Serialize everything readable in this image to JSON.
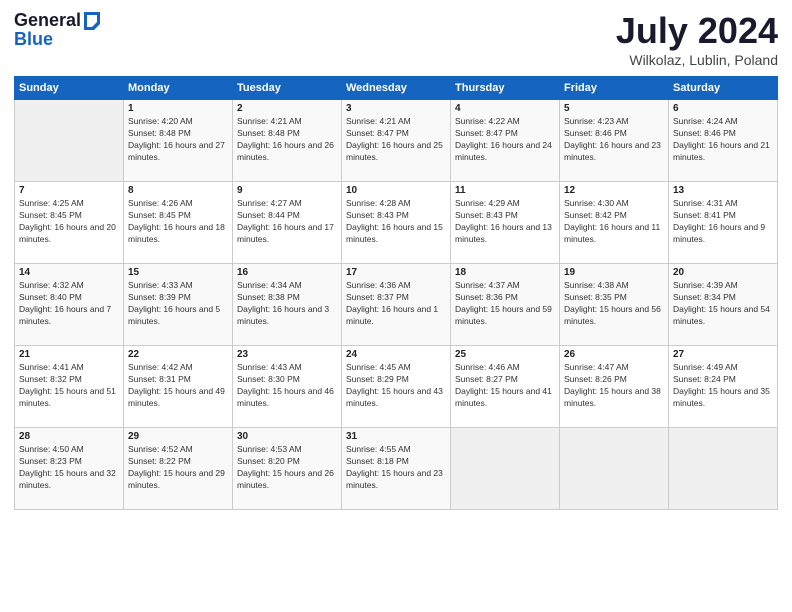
{
  "logo": {
    "line1": "General",
    "line2": "Blue"
  },
  "title": "July 2024",
  "location": "Wilkolaz, Lublin, Poland",
  "headers": [
    "Sunday",
    "Monday",
    "Tuesday",
    "Wednesday",
    "Thursday",
    "Friday",
    "Saturday"
  ],
  "weeks": [
    [
      {
        "day": "",
        "sunrise": "",
        "sunset": "",
        "daylight": ""
      },
      {
        "day": "1",
        "sunrise": "Sunrise: 4:20 AM",
        "sunset": "Sunset: 8:48 PM",
        "daylight": "Daylight: 16 hours and 27 minutes."
      },
      {
        "day": "2",
        "sunrise": "Sunrise: 4:21 AM",
        "sunset": "Sunset: 8:48 PM",
        "daylight": "Daylight: 16 hours and 26 minutes."
      },
      {
        "day": "3",
        "sunrise": "Sunrise: 4:21 AM",
        "sunset": "Sunset: 8:47 PM",
        "daylight": "Daylight: 16 hours and 25 minutes."
      },
      {
        "day": "4",
        "sunrise": "Sunrise: 4:22 AM",
        "sunset": "Sunset: 8:47 PM",
        "daylight": "Daylight: 16 hours and 24 minutes."
      },
      {
        "day": "5",
        "sunrise": "Sunrise: 4:23 AM",
        "sunset": "Sunset: 8:46 PM",
        "daylight": "Daylight: 16 hours and 23 minutes."
      },
      {
        "day": "6",
        "sunrise": "Sunrise: 4:24 AM",
        "sunset": "Sunset: 8:46 PM",
        "daylight": "Daylight: 16 hours and 21 minutes."
      }
    ],
    [
      {
        "day": "7",
        "sunrise": "Sunrise: 4:25 AM",
        "sunset": "Sunset: 8:45 PM",
        "daylight": "Daylight: 16 hours and 20 minutes."
      },
      {
        "day": "8",
        "sunrise": "Sunrise: 4:26 AM",
        "sunset": "Sunset: 8:45 PM",
        "daylight": "Daylight: 16 hours and 18 minutes."
      },
      {
        "day": "9",
        "sunrise": "Sunrise: 4:27 AM",
        "sunset": "Sunset: 8:44 PM",
        "daylight": "Daylight: 16 hours and 17 minutes."
      },
      {
        "day": "10",
        "sunrise": "Sunrise: 4:28 AM",
        "sunset": "Sunset: 8:43 PM",
        "daylight": "Daylight: 16 hours and 15 minutes."
      },
      {
        "day": "11",
        "sunrise": "Sunrise: 4:29 AM",
        "sunset": "Sunset: 8:43 PM",
        "daylight": "Daylight: 16 hours and 13 minutes."
      },
      {
        "day": "12",
        "sunrise": "Sunrise: 4:30 AM",
        "sunset": "Sunset: 8:42 PM",
        "daylight": "Daylight: 16 hours and 11 minutes."
      },
      {
        "day": "13",
        "sunrise": "Sunrise: 4:31 AM",
        "sunset": "Sunset: 8:41 PM",
        "daylight": "Daylight: 16 hours and 9 minutes."
      }
    ],
    [
      {
        "day": "14",
        "sunrise": "Sunrise: 4:32 AM",
        "sunset": "Sunset: 8:40 PM",
        "daylight": "Daylight: 16 hours and 7 minutes."
      },
      {
        "day": "15",
        "sunrise": "Sunrise: 4:33 AM",
        "sunset": "Sunset: 8:39 PM",
        "daylight": "Daylight: 16 hours and 5 minutes."
      },
      {
        "day": "16",
        "sunrise": "Sunrise: 4:34 AM",
        "sunset": "Sunset: 8:38 PM",
        "daylight": "Daylight: 16 hours and 3 minutes."
      },
      {
        "day": "17",
        "sunrise": "Sunrise: 4:36 AM",
        "sunset": "Sunset: 8:37 PM",
        "daylight": "Daylight: 16 hours and 1 minute."
      },
      {
        "day": "18",
        "sunrise": "Sunrise: 4:37 AM",
        "sunset": "Sunset: 8:36 PM",
        "daylight": "Daylight: 15 hours and 59 minutes."
      },
      {
        "day": "19",
        "sunrise": "Sunrise: 4:38 AM",
        "sunset": "Sunset: 8:35 PM",
        "daylight": "Daylight: 15 hours and 56 minutes."
      },
      {
        "day": "20",
        "sunrise": "Sunrise: 4:39 AM",
        "sunset": "Sunset: 8:34 PM",
        "daylight": "Daylight: 15 hours and 54 minutes."
      }
    ],
    [
      {
        "day": "21",
        "sunrise": "Sunrise: 4:41 AM",
        "sunset": "Sunset: 8:32 PM",
        "daylight": "Daylight: 15 hours and 51 minutes."
      },
      {
        "day": "22",
        "sunrise": "Sunrise: 4:42 AM",
        "sunset": "Sunset: 8:31 PM",
        "daylight": "Daylight: 15 hours and 49 minutes."
      },
      {
        "day": "23",
        "sunrise": "Sunrise: 4:43 AM",
        "sunset": "Sunset: 8:30 PM",
        "daylight": "Daylight: 15 hours and 46 minutes."
      },
      {
        "day": "24",
        "sunrise": "Sunrise: 4:45 AM",
        "sunset": "Sunset: 8:29 PM",
        "daylight": "Daylight: 15 hours and 43 minutes."
      },
      {
        "day": "25",
        "sunrise": "Sunrise: 4:46 AM",
        "sunset": "Sunset: 8:27 PM",
        "daylight": "Daylight: 15 hours and 41 minutes."
      },
      {
        "day": "26",
        "sunrise": "Sunrise: 4:47 AM",
        "sunset": "Sunset: 8:26 PM",
        "daylight": "Daylight: 15 hours and 38 minutes."
      },
      {
        "day": "27",
        "sunrise": "Sunrise: 4:49 AM",
        "sunset": "Sunset: 8:24 PM",
        "daylight": "Daylight: 15 hours and 35 minutes."
      }
    ],
    [
      {
        "day": "28",
        "sunrise": "Sunrise: 4:50 AM",
        "sunset": "Sunset: 8:23 PM",
        "daylight": "Daylight: 15 hours and 32 minutes."
      },
      {
        "day": "29",
        "sunrise": "Sunrise: 4:52 AM",
        "sunset": "Sunset: 8:22 PM",
        "daylight": "Daylight: 15 hours and 29 minutes."
      },
      {
        "day": "30",
        "sunrise": "Sunrise: 4:53 AM",
        "sunset": "Sunset: 8:20 PM",
        "daylight": "Daylight: 15 hours and 26 minutes."
      },
      {
        "day": "31",
        "sunrise": "Sunrise: 4:55 AM",
        "sunset": "Sunset: 8:18 PM",
        "daylight": "Daylight: 15 hours and 23 minutes."
      },
      {
        "day": "",
        "sunrise": "",
        "sunset": "",
        "daylight": ""
      },
      {
        "day": "",
        "sunrise": "",
        "sunset": "",
        "daylight": ""
      },
      {
        "day": "",
        "sunrise": "",
        "sunset": "",
        "daylight": ""
      }
    ]
  ]
}
